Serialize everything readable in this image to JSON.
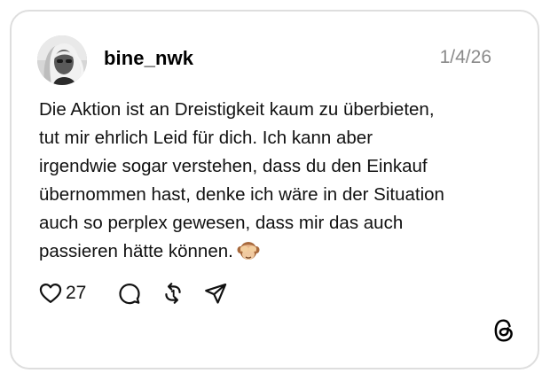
{
  "post": {
    "username": "bine_nwk",
    "date": "1/4/26",
    "text_lines": [
      "Die Aktion ist an Dreistigkeit kaum zu überbieten,",
      "tut mir ehrlich Leid für dich. Ich kann aber",
      "irgendwie sogar verstehen, dass du den Einkauf",
      "übernommen hast, denke ich wäre in der Situation",
      "auch so perplex gewesen, dass mir das auch",
      "passieren hätte können."
    ],
    "emoji": "see-no-evil-monkey-emoji"
  },
  "actions": {
    "like_count": "27",
    "icons": [
      "heart-icon",
      "comment-icon",
      "repost-icon",
      "share-icon"
    ]
  },
  "branding": {
    "logo": "threads-logo"
  },
  "colors": {
    "border": "#dedede",
    "date": "#8a8a8a",
    "text": "#111111"
  }
}
